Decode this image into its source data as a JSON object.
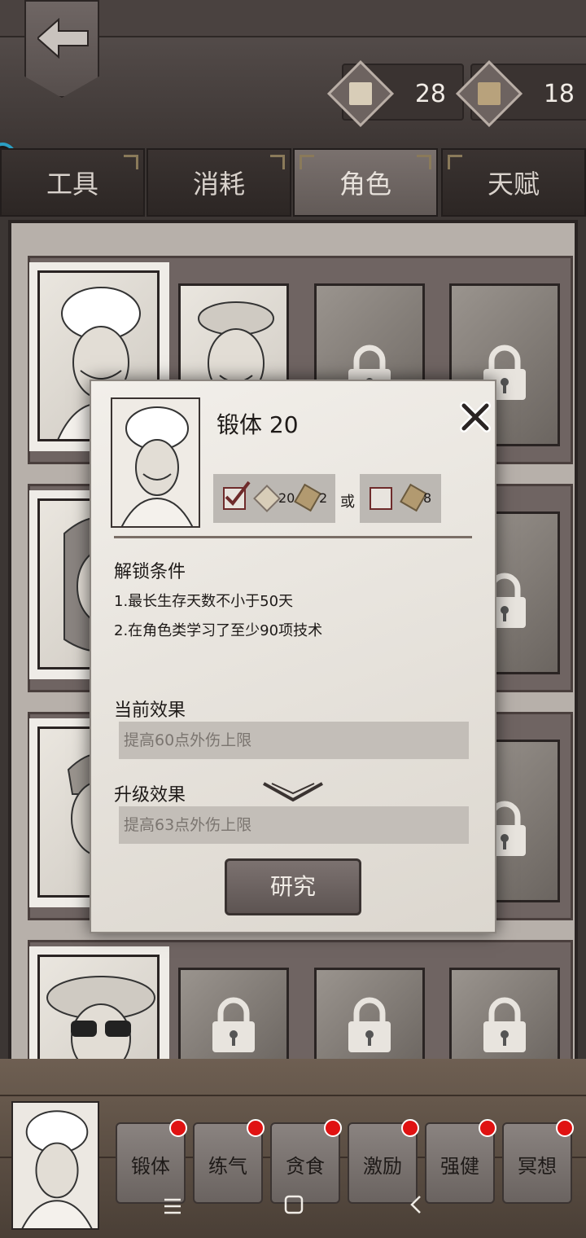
{
  "header": {
    "resources": [
      {
        "name": "paper-resource",
        "value": "28"
      },
      {
        "name": "book-resource",
        "value": "18"
      }
    ]
  },
  "tabs": [
    {
      "label": "工具",
      "active": false
    },
    {
      "label": "消耗",
      "active": false
    },
    {
      "label": "角色",
      "active": true
    },
    {
      "label": "天赋",
      "active": false
    }
  ],
  "popup": {
    "title": "锻体 20",
    "cost_option_1": {
      "paper": "20",
      "book": "2",
      "checked": true
    },
    "or_label": "或",
    "cost_option_2": {
      "book": "8",
      "checked": false
    },
    "unlock_title": "解锁条件",
    "conditions": [
      "1.最长生存天数不小于50天",
      "2.在角色类学习了至少90项技术"
    ],
    "current_effect_title": "当前效果",
    "current_effect": "提高60点外伤上限",
    "upgrade_effect_title": "升级效果",
    "upgrade_effect": "提高63点外伤上限",
    "research_label": "研究"
  },
  "skills": [
    {
      "label": "锻体"
    },
    {
      "label": "练气"
    },
    {
      "label": "贪食"
    },
    {
      "label": "激励"
    },
    {
      "label": "强健"
    },
    {
      "label": "冥想"
    }
  ],
  "colors": {
    "badge": "#e01212",
    "check": "#6e2b2b"
  }
}
